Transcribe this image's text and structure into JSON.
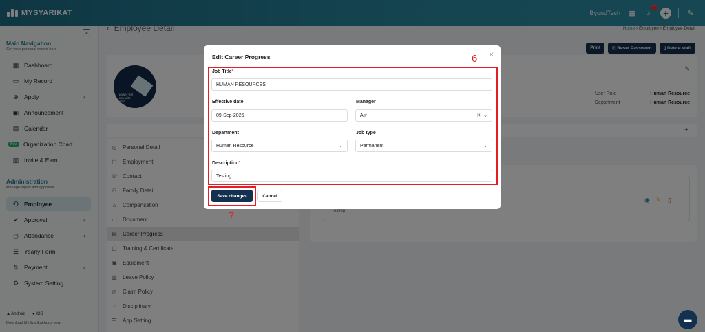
{
  "app": {
    "name": "MYSYARIKAT",
    "company": "ByondTech",
    "notif_count": "11"
  },
  "sidebar": {
    "main_title": "Main Navigation",
    "main_sub": "Get your personal record here",
    "main_items": [
      {
        "label": "Dashboard",
        "icon": "dashboard-icon"
      },
      {
        "label": "My Record",
        "icon": "folder-icon"
      },
      {
        "label": "Apply",
        "icon": "apply-icon"
      },
      {
        "label": "Announcement",
        "icon": "announcement-icon"
      },
      {
        "label": "Calendar",
        "icon": "calendar-icon"
      },
      {
        "label": "Organization Chart",
        "icon": "org-chart-icon",
        "badge": "New"
      },
      {
        "label": "Invite & Earn",
        "icon": "gift-icon"
      }
    ],
    "admin_title": "Administration",
    "admin_sub": "Manage report and approval",
    "admin_items": [
      {
        "label": "Employee",
        "icon": "users-icon"
      },
      {
        "label": "Approval",
        "icon": "check-circle-icon"
      },
      {
        "label": "Attendance",
        "icon": "clock-icon"
      },
      {
        "label": "Yearly Form",
        "icon": "list-icon"
      },
      {
        "label": "Payment",
        "icon": "dollar-icon"
      },
      {
        "label": "System Setting",
        "icon": "gear-icon"
      }
    ],
    "app_android": "Android",
    "app_ios": "IOS",
    "apps_sub": "Download MySyarikat Apps now!"
  },
  "page": {
    "title": "Employee Detail",
    "breadcrumb": [
      "Home",
      "Employee",
      "Employee Detail"
    ],
    "actions": {
      "print": "Print",
      "reset": "Reset Password",
      "delete": "Delete staff"
    },
    "info": [
      {
        "label": "User Role",
        "value": "Human Resource"
      },
      {
        "label": "Department",
        "value": "Human Resource"
      }
    ],
    "avatar_text": [
      "power will",
      "any with",
      "drat."
    ],
    "menu": [
      "Personal Detail",
      "Employment",
      "Contact",
      "Family Detail",
      "Compensation",
      "Document",
      "Career Progress",
      "Training & Certificate",
      "Equipment",
      "Leave Policy",
      "Claim Policy",
      "Disciplinary",
      "App Setting"
    ],
    "record_text": "Testing"
  },
  "modal": {
    "title": "Edit Career Progress",
    "job_title": {
      "label": "Job Title",
      "value": "HUMAN RESOURCES"
    },
    "effective_date": {
      "label": "Effective date",
      "value": "09-Sep-2025"
    },
    "manager": {
      "label": "Manager",
      "value": "Alif"
    },
    "department": {
      "label": "Department",
      "value": "Human Resource"
    },
    "job_type": {
      "label": "Job type",
      "value": "Permanent"
    },
    "description": {
      "label": "Description",
      "value": "Testing"
    },
    "save": "Save changes",
    "cancel": "Cancel"
  },
  "annotations": {
    "fields_step": "6",
    "save_step": "7",
    "color": "#e31e24"
  }
}
